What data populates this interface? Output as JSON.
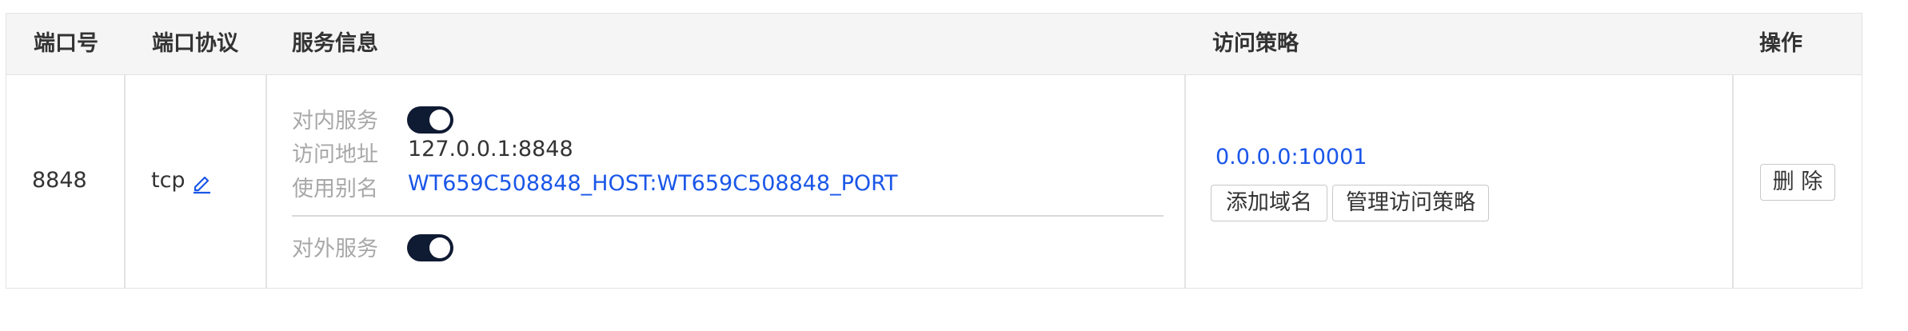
{
  "header": {
    "port": "端口号",
    "protocol": "端口协议",
    "service_info": "服务信息",
    "access_policy": "访问策略",
    "actions": "操作"
  },
  "row": {
    "port": "8848",
    "protocol": "tcp",
    "internal": {
      "label": "对内服务",
      "enabled": true,
      "address_label": "访问地址",
      "address": "127.0.0.1:8848",
      "alias_label": "使用别名",
      "alias": "WT659C508848_HOST:WT659C508848_PORT"
    },
    "external": {
      "label": "对外服务",
      "enabled": true
    },
    "policy_address": "0.0.0.0:10001",
    "add_domain_label": "添加域名",
    "manage_policy_label": "管理访问策略",
    "delete_label": "删 除"
  },
  "colors": {
    "link": "#1a56e8",
    "toggle_on": "#0f1a33",
    "header_bg": "#f5f5f5",
    "border": "#e3e3e3"
  }
}
